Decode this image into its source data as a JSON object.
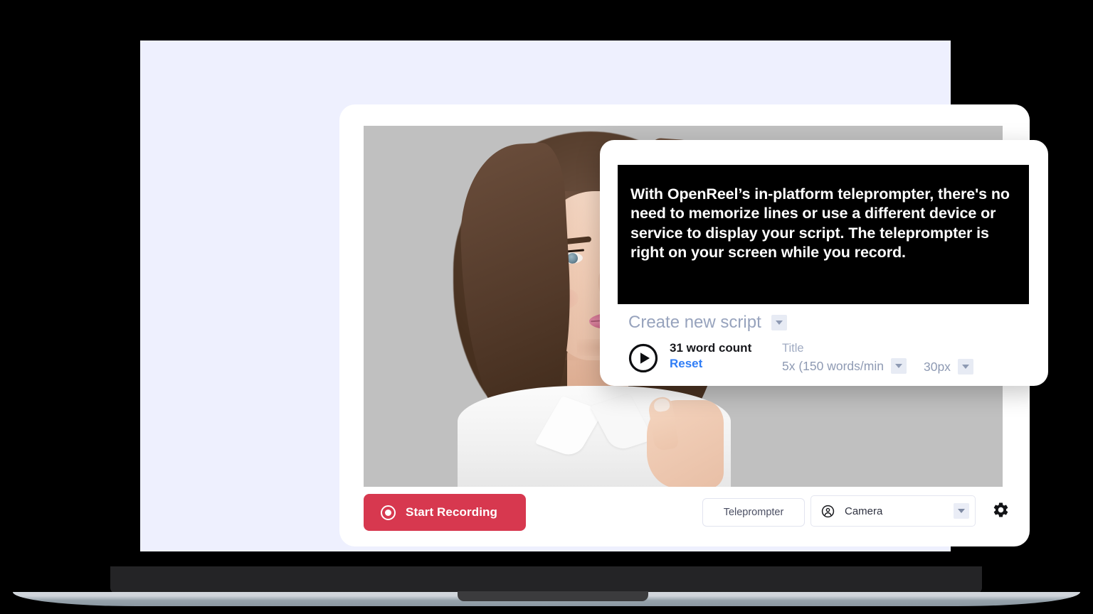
{
  "device": {
    "name": "laptop-mockup",
    "screen_bg": "#eef0fe",
    "bezel_color": "#242426",
    "base_color": "#96a2ab"
  },
  "app": {
    "card_bg": "#ffffff",
    "accent_color": "#d7384f",
    "link_color": "#2f7df6",
    "muted_color": "#8e9ab3"
  },
  "video": {
    "name": "camera-preview",
    "background": "#c0c0c0"
  },
  "bottom_bar": {
    "record_button_label": "Start Recording",
    "teleprompter_button_label": "Teleprompter",
    "camera_select_value": "Camera",
    "camera_icon": "account-circle-icon",
    "settings_icon": "gear-icon",
    "record_icon": "record-circle-icon",
    "caret_icon": "chevron-down-icon"
  },
  "teleprompter": {
    "prompt_text": "With OpenReel’s in-platform teleprompter, there's no need to memorize lines or use a different device or service to display your script. The teleprompter is right on your screen while you record.",
    "script_select_value": "Create new script",
    "play_icon": "play-circle-icon",
    "word_count_label": "31 word count",
    "reset_label": "Reset",
    "speed_field_title": "Title",
    "speed_value": "5x (150 words/min",
    "font_size_value": "30px",
    "caret_icon": "chevron-down-icon"
  }
}
